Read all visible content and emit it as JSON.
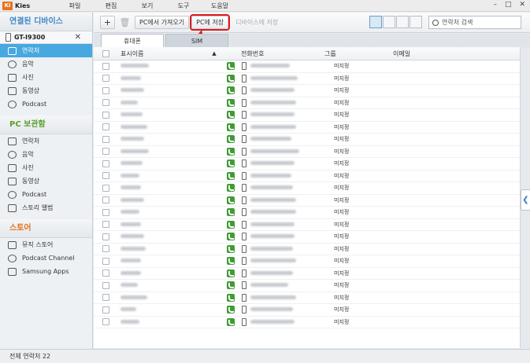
{
  "app": {
    "logo": "Ki",
    "name": "Kies"
  },
  "menu": [
    "파일",
    "편집",
    "보기",
    "도구",
    "도움말"
  ],
  "sidebar": {
    "connected_header": "연결된 디바이스",
    "device_name": "GT-I9300",
    "device_items": [
      {
        "label": "연락처",
        "icon": "contacts-icon",
        "active": true
      },
      {
        "label": "음악",
        "icon": "music-icon"
      },
      {
        "label": "사진",
        "icon": "photo-icon"
      },
      {
        "label": "동영상",
        "icon": "video-icon"
      },
      {
        "label": "Podcast",
        "icon": "podcast-icon"
      }
    ],
    "pc_header": "PC 보관함",
    "pc_items": [
      {
        "label": "연락처",
        "icon": "contacts-icon"
      },
      {
        "label": "음악",
        "icon": "music-icon"
      },
      {
        "label": "사진",
        "icon": "photo-icon"
      },
      {
        "label": "동영상",
        "icon": "video-icon"
      },
      {
        "label": "Podcast",
        "icon": "podcast-icon"
      },
      {
        "label": "스토리 앨범",
        "icon": "album-icon"
      }
    ],
    "store_header": "스토어",
    "store_items": [
      {
        "label": "뮤직 스토어",
        "icon": "music-store-icon"
      },
      {
        "label": "Podcast Channel",
        "icon": "podcast-icon"
      },
      {
        "label": "Samsung Apps",
        "icon": "apps-icon"
      }
    ]
  },
  "toolbar": {
    "add": "+",
    "delete": "🗑",
    "import_from_pc": "PC에서 가져오기",
    "save_to_pc": "PC에 저장",
    "save_to_device": "디바이스에 저장",
    "search_placeholder": "연락처 검색"
  },
  "tabs": [
    "휴대폰",
    "SIM"
  ],
  "table": {
    "headers": {
      "name": "표시이름",
      "sort": "▲",
      "phone": "전화번호",
      "group": "그룹",
      "email": "이메일"
    },
    "group_value": "미지정",
    "row_count": 22
  },
  "status": "전체 연락처 22",
  "colors": {
    "accent_blue": "#3f86c5",
    "pc_green": "#5a9e2e",
    "store_orange": "#e0701a",
    "selected": "#48a8e0",
    "annotation_red": "#e01a1a"
  }
}
